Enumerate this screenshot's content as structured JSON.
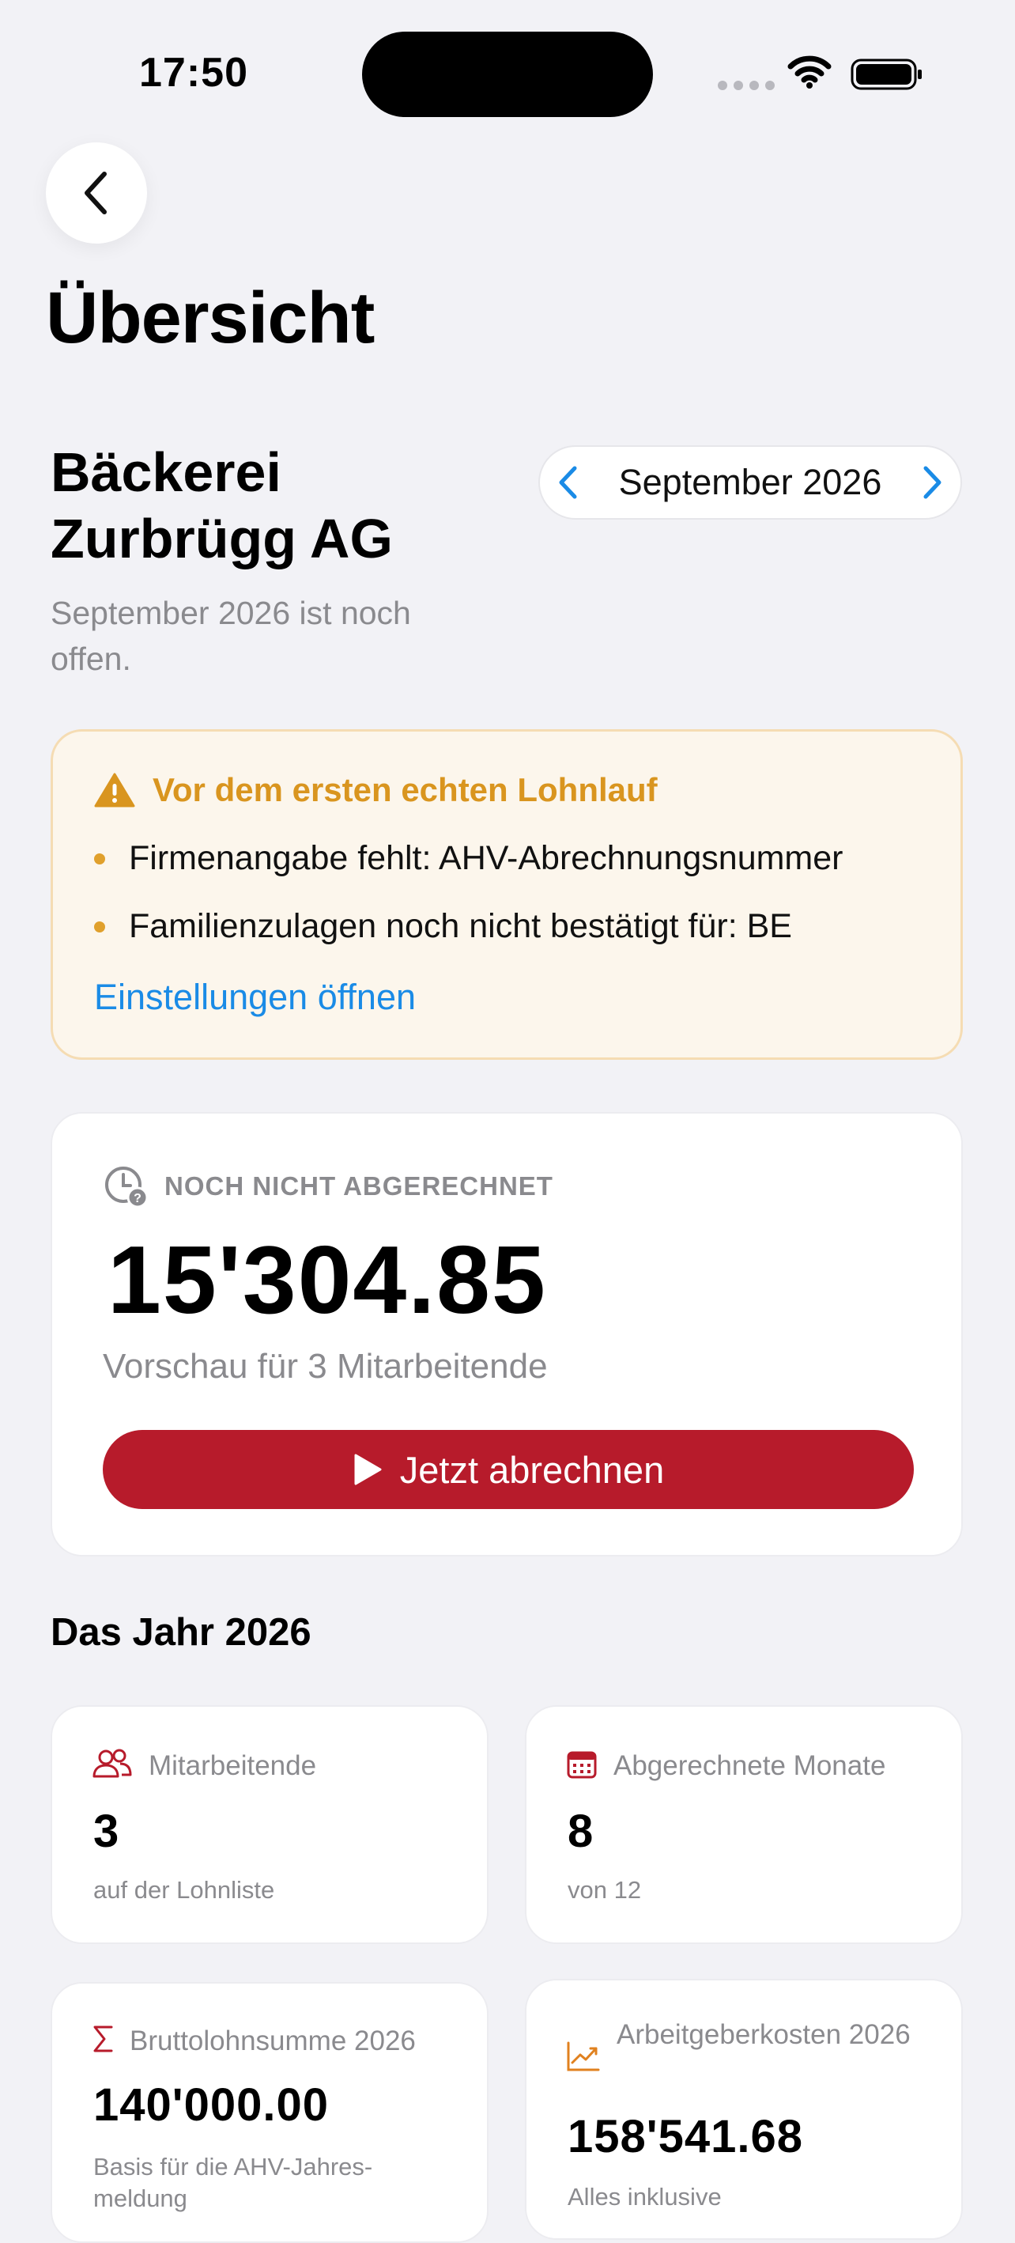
{
  "status": {
    "time": "17:50"
  },
  "nav": {
    "back_label": "Zurück"
  },
  "page": {
    "title": "Übersicht"
  },
  "company": {
    "name": "Bäckerei Zurbrügg AG",
    "period_note": "September 2026 ist noch offen."
  },
  "month_picker": {
    "label": "September 2026"
  },
  "warning": {
    "title": "Vor dem ersten echten Lohnlauf",
    "items": [
      "Firmenangabe fehlt: AHV-Abrechnungsnummer",
      "Familienzulagen noch nicht bestätigt für: BE"
    ],
    "link": "Einstellungen öffnen"
  },
  "pending": {
    "label": "NOCH NICHT ABGERECHNET",
    "amount": "15'304.85",
    "sub": "Vorschau für 3 Mitarbeitende",
    "button": "Jetzt abrechnen"
  },
  "year": {
    "title": "Das Jahr 2026",
    "stats": [
      {
        "label": "Mitarbeitende",
        "value": "3",
        "sub": "auf der Lohnliste",
        "icon": "people-icon"
      },
      {
        "label": "Abgerechnete Monate",
        "value": "8",
        "sub": "von 12",
        "icon": "calendar-icon"
      },
      {
        "label": "Bruttolohnsumme 2026",
        "value": "140'000.00",
        "sub": "Basis für die AHV-Jahres-meldung",
        "icon": "sigma-icon"
      },
      {
        "label": "Arbeitgeberkosten 2026",
        "value": "158'541.68",
        "sub": "Alles inklusive",
        "icon": "chart-trend-icon"
      }
    ]
  },
  "colors": {
    "accent_red": "#b71b2b",
    "warning_orange": "#d9951f",
    "link_blue": "#1a8be6",
    "background": "#f2f2f6"
  }
}
